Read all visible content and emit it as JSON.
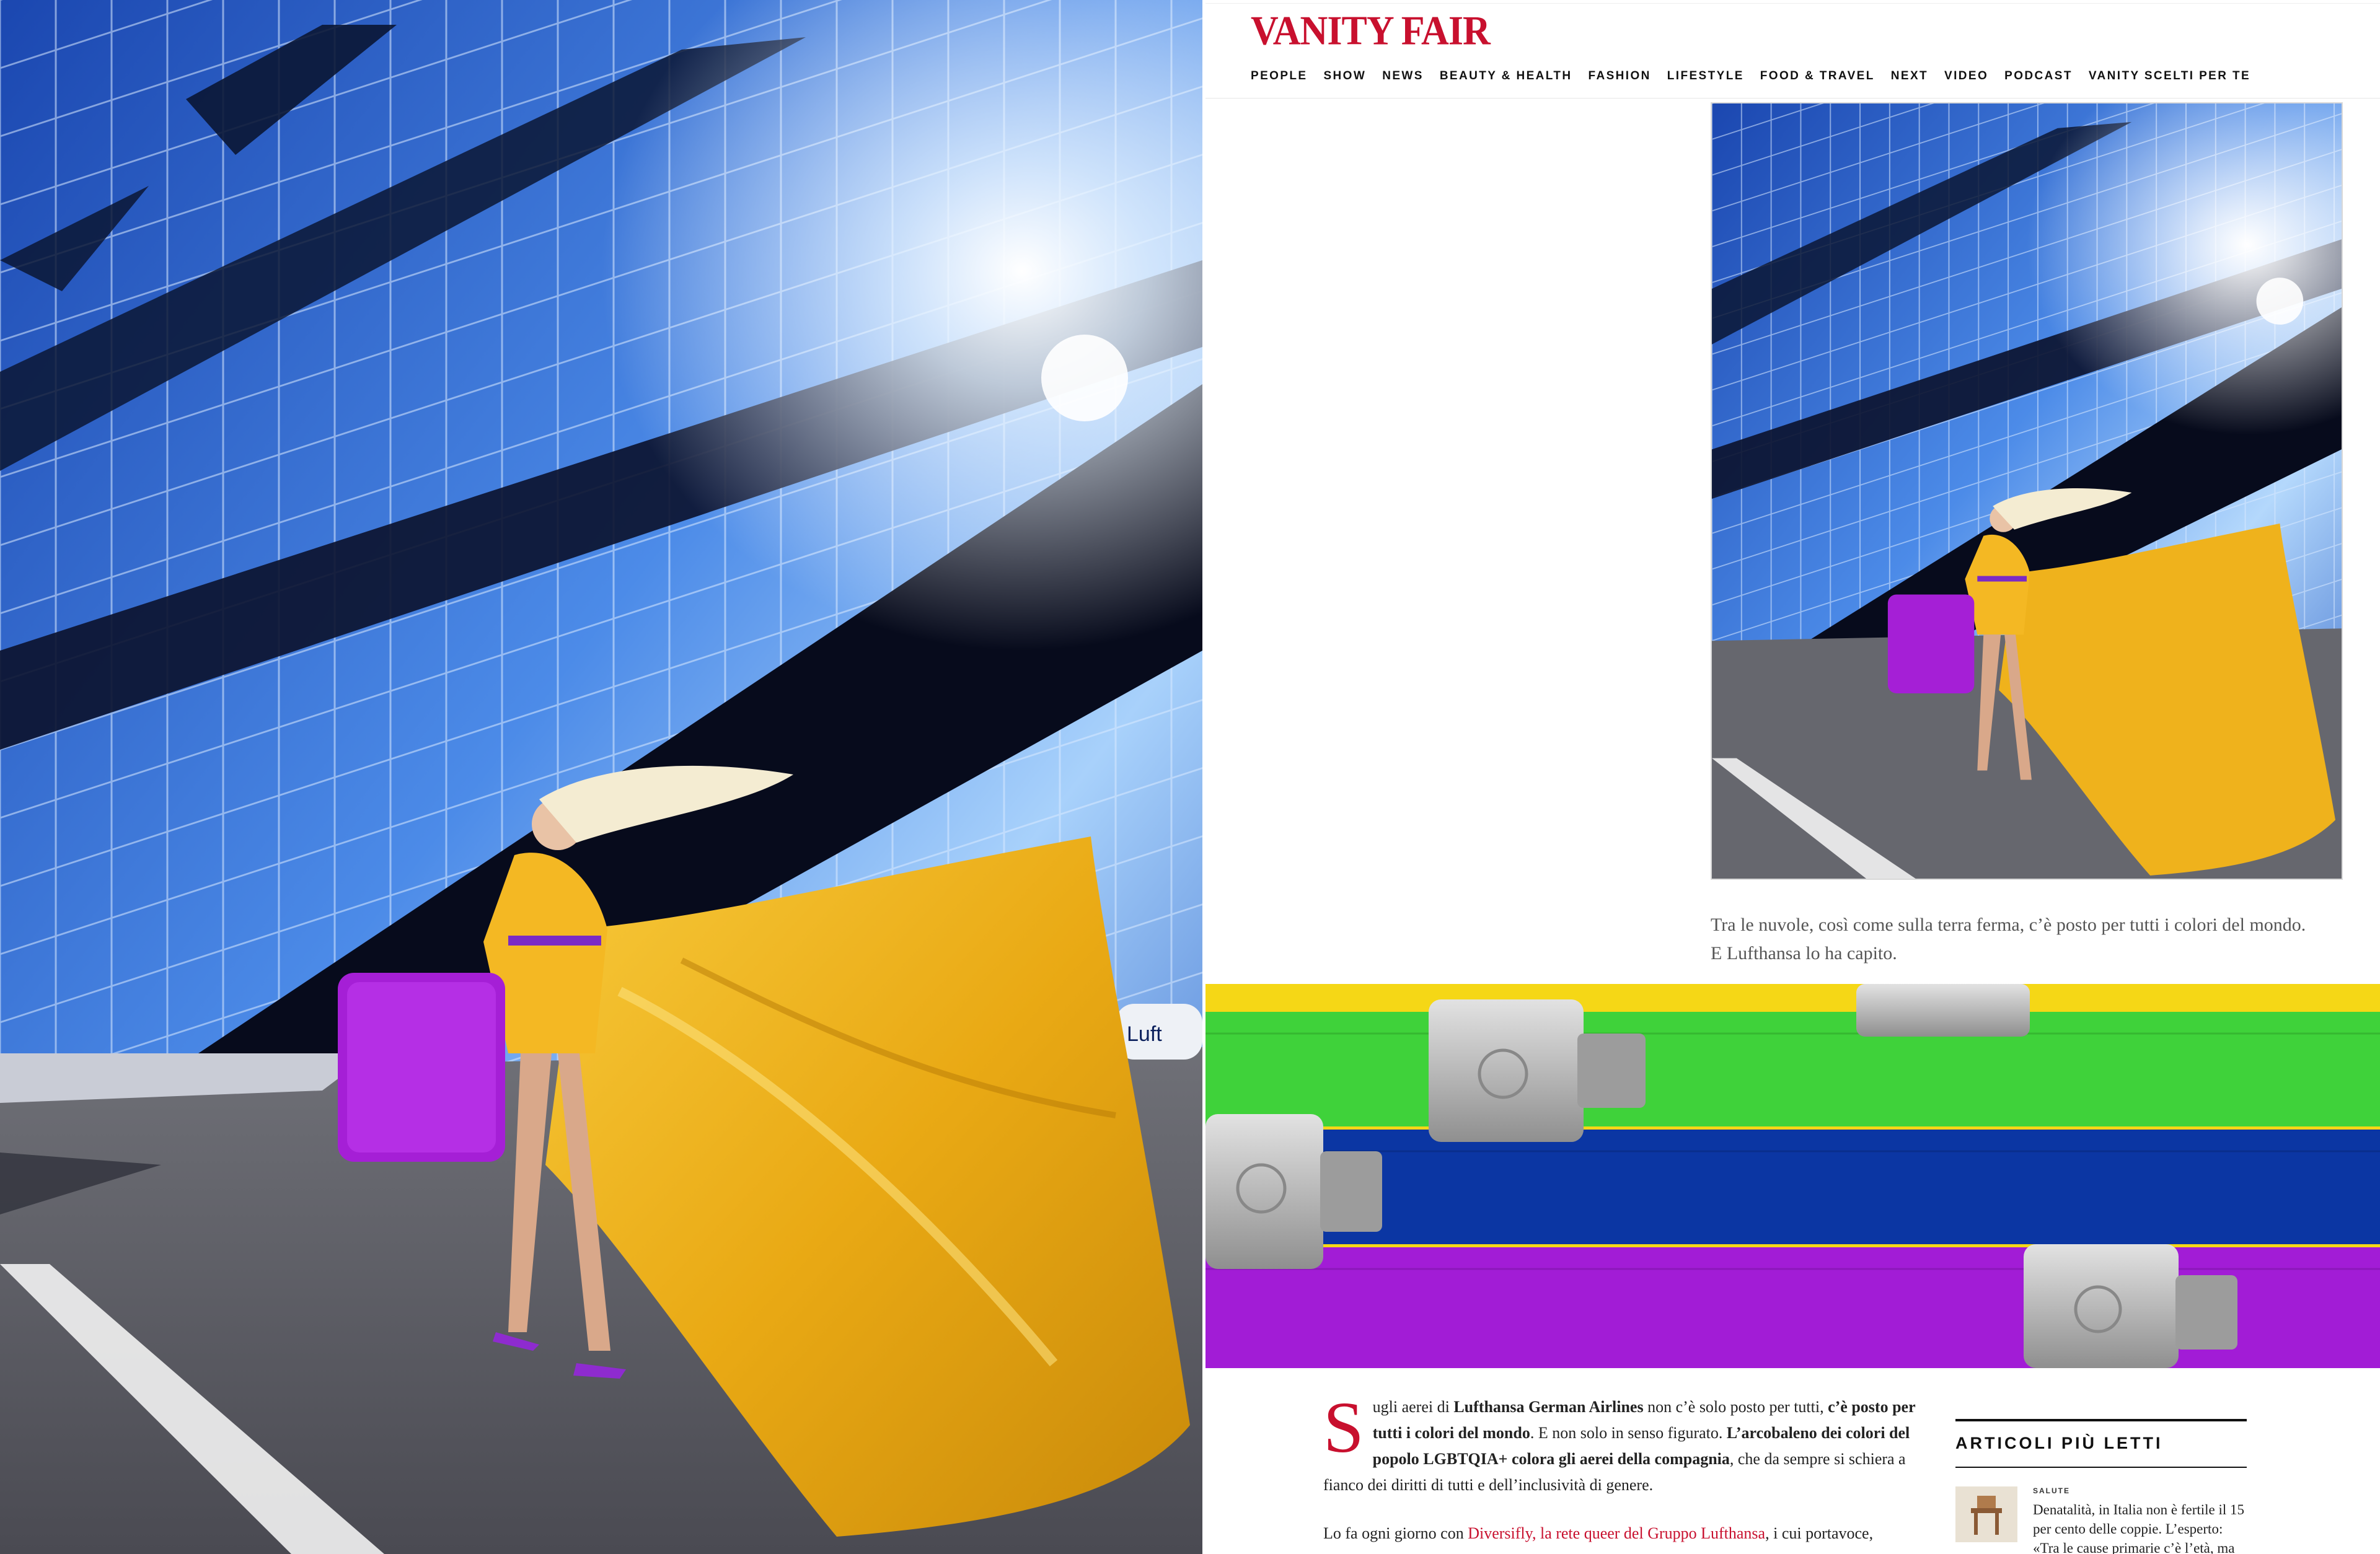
{
  "brand": {
    "logo": "VANITY FAIR",
    "accent": "#c8102e"
  },
  "nav": {
    "items": [
      "PEOPLE",
      "SHOW",
      "NEWS",
      "BEAUTY & HEALTH",
      "FASHION",
      "LIFESTYLE",
      "FOOD & TRAVEL",
      "NEXT",
      "VIDEO",
      "PODCAST",
      "VANITY SCELTI PER TE"
    ]
  },
  "article": {
    "caption": "Tra le nuvole, così come sulla terra ferma, c’è posto per tutti i colori del mondo. E Lufthansa lo ha capito.",
    "dropcap": "S",
    "p1": {
      "t1": "ugli aerei di ",
      "b1": "Lufthansa German Airlines",
      "t2": " non c’è solo posto per tutti, ",
      "b2": "c’è posto per tutti i colori del mondo",
      "t3": ". E non solo in senso figurato. ",
      "b3": "L’arcobaleno dei colori del popolo LGBTQIA+ colora gli aerei della compagnia",
      "t4": ", che da sempre si schiera a fianco dei diritti di tutti e dell’inclusività di genere."
    },
    "p2": {
      "t1": "Lo fa ogni giorno con ",
      "link": "Diversifly, la rete queer del Gruppo Lufthansa",
      "t2": ", i cui portavoce,"
    }
  },
  "sidebar": {
    "title": "ARTICOLI PIÙ LETTI",
    "items": [
      {
        "kicker": "SALUTE",
        "text": "Denatalità, in Italia non è fertile il 15 per cento delle coppie. L’esperto: «Tra le cause primarie c’è l’età, ma non"
      }
    ]
  },
  "photo": {
    "suitcase_color": "#a51fd6",
    "dress_color": "#f2b31b",
    "plane_text": "Luft"
  }
}
